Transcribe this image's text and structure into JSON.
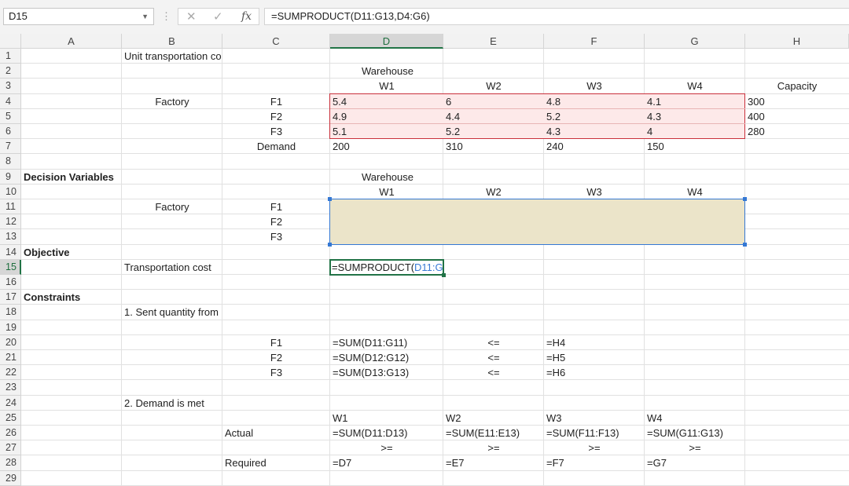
{
  "namebox": "D15",
  "formula_bar": "=SUMPRODUCT(D11:G13,D4:G6)",
  "fx_label": "fx",
  "columns": [
    "A",
    "B",
    "C",
    "D",
    "E",
    "F",
    "G",
    "H"
  ],
  "rows": [
    "1",
    "2",
    "3",
    "4",
    "5",
    "6",
    "7",
    "8",
    "9",
    "10",
    "11",
    "12",
    "13",
    "14",
    "15",
    "16",
    "17",
    "18",
    "19",
    "20",
    "21",
    "22",
    "23",
    "24",
    "25",
    "26",
    "27",
    "28",
    "29"
  ],
  "cells": {
    "r1": {
      "B": "Unit transportation co"
    },
    "r2": {
      "warehouse": "Warehouse"
    },
    "r3": {
      "W1": "W1",
      "W2": "W2",
      "W3": "W3",
      "W4": "W4",
      "H": "Capacity"
    },
    "r4": {
      "B": "Factory",
      "C": "F1",
      "D": "5.4",
      "E": "6",
      "F": "4.8",
      "G": "4.1",
      "H": "300"
    },
    "r5": {
      "C": "F2",
      "D": "4.9",
      "E": "4.4",
      "F": "5.2",
      "G": "4.3",
      "H": "400"
    },
    "r6": {
      "C": "F3",
      "D": "5.1",
      "E": "5.2",
      "F": "4.3",
      "G": "4",
      "H": "280"
    },
    "r7": {
      "C": "Demand",
      "D": "200",
      "E": "310",
      "F": "240",
      "G": "150"
    },
    "r9": {
      "A": "Decision Variables",
      "warehouse": "Warehouse"
    },
    "r10": {
      "W1": "W1",
      "W2": "W2",
      "W3": "W3",
      "W4": "W4"
    },
    "r11": {
      "B": "Factory",
      "C": "F1"
    },
    "r12": {
      "C": "F2"
    },
    "r13": {
      "C": "F3"
    },
    "r14": {
      "A": "Objective"
    },
    "r15": {
      "B": "Transportation cost",
      "D_plain": "=SUMPRODUCT(",
      "D_ref": "D11:G1"
    },
    "r17": {
      "A": "Constraints"
    },
    "r18": {
      "B": "1. Sent quantity from"
    },
    "r20": {
      "C": "F1",
      "D": "=SUM(D11:G11)",
      "E": "<=",
      "F": "=H4"
    },
    "r21": {
      "C": "F2",
      "D": "=SUM(D12:G12)",
      "E": "<=",
      "F": "=H5"
    },
    "r22": {
      "C": "F3",
      "D": "=SUM(D13:G13)",
      "E": "<=",
      "F": "=H6"
    },
    "r24": {
      "B": "2. Demand is met"
    },
    "r25": {
      "D": "W1",
      "E": "W2",
      "F": "W3",
      "G": "W4"
    },
    "r26": {
      "C": "Actual",
      "D": "=SUM(D11:D13)",
      "E": "=SUM(E11:E13)",
      "F": "=SUM(F11:F13)",
      "G": "=SUM(G11:G13)"
    },
    "r27": {
      "D": ">=",
      "E": ">=",
      "F": ">=",
      "G": ">="
    },
    "r28": {
      "C": "Required",
      "D": "=D7",
      "E": "=E7",
      "F": "=F7",
      "G": "=G7"
    }
  }
}
